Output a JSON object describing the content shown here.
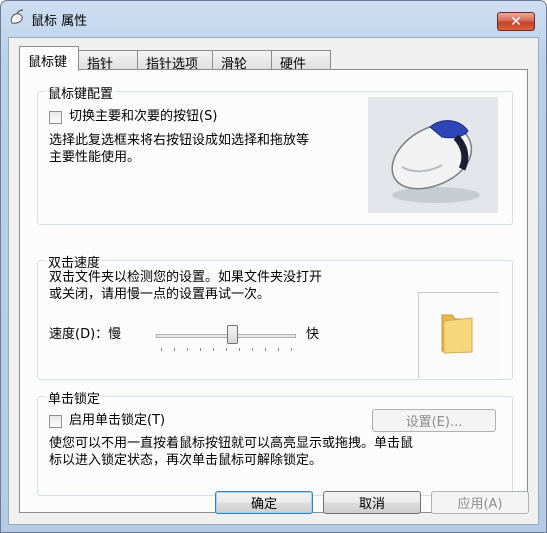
{
  "window": {
    "title": "鼠标 属性",
    "close_glyph": "✕"
  },
  "tabs": [
    {
      "label": "鼠标键"
    },
    {
      "label": "指针"
    },
    {
      "label": "指针选项"
    },
    {
      "label": "滑轮"
    },
    {
      "label": "硬件"
    }
  ],
  "button_config": {
    "title": "鼠标键配置",
    "switch_label": "切换主要和次要的按钮(S)",
    "description_line1": "选择此复选框来将右按钮设成如选择和拖放等",
    "description_line2": "主要性能使用。"
  },
  "double_click": {
    "title": "双击速度",
    "description_line1": "双击文件夹以检测您的设置。如果文件夹没打开",
    "description_line2": "或关闭，请用慢一点的设置再试一次。",
    "speed_label": "速度(D)：慢",
    "fast_label": "快",
    "speed_fraction": 0.55
  },
  "click_lock": {
    "title": "单击锁定",
    "enable_label": "启用单击锁定(T)",
    "settings_label": "设置(E)...",
    "description_line1": "使您可以不用一直按着鼠标按钮就可以高亮显示或拖拽。单击鼠",
    "description_line2": "标以进入锁定状态，再次单击鼠标可解除锁定。"
  },
  "footer": {
    "ok_label": "确定",
    "cancel_label": "取消",
    "apply_label": "应用(A)"
  }
}
